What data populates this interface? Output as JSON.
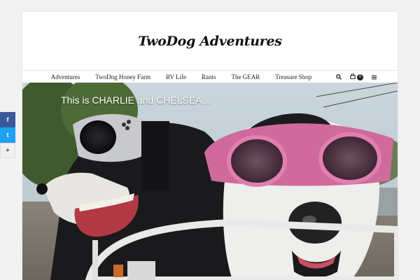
{
  "site": {
    "title": "TwoDog Adventures"
  },
  "nav": {
    "items": [
      {
        "label": "Adventures"
      },
      {
        "label": "TwoDog Honey Farm"
      },
      {
        "label": "RV Life"
      },
      {
        "label": "Rants"
      },
      {
        "label": "The GEAR"
      },
      {
        "label": "Treasure Shop"
      }
    ],
    "cart_count": "0",
    "icons": [
      "search-icon",
      "cart-icon",
      "menu-icon"
    ]
  },
  "hero": {
    "caption": "This is CHARLIE and CHELSEA..."
  },
  "share": {
    "facebook_label": "f",
    "twitter_label": "t",
    "more_label": "+"
  },
  "colors": {
    "facebook": "#3b5998",
    "twitter": "#1da1f2"
  }
}
